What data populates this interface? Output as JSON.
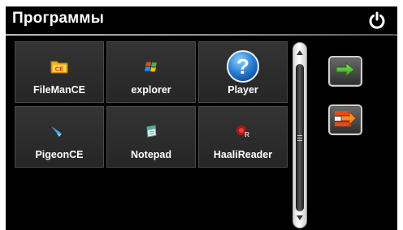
{
  "titlebar": {
    "title": "Программы",
    "power_icon": "power-icon"
  },
  "apps": [
    {
      "label": "FileManCE",
      "icon": "fileman-icon"
    },
    {
      "label": "explorer",
      "icon": "windows-flag-icon"
    },
    {
      "label": "Player",
      "icon": "help-question-icon"
    },
    {
      "label": "PigeonCE",
      "icon": "pigeon-icon"
    },
    {
      "label": "Notepad",
      "icon": "notepad-icon"
    },
    {
      "label": "HaaliReader",
      "icon": "haali-reader-icon"
    }
  ],
  "buttons": {
    "next_icon": "green-arrow-right-icon",
    "exit_icon": "exit-arrow-icon"
  },
  "colors": {
    "background": "#000000",
    "tile": "#2e2e2e",
    "accent_green": "#3fb62e",
    "accent_orange": "#e8702a"
  }
}
